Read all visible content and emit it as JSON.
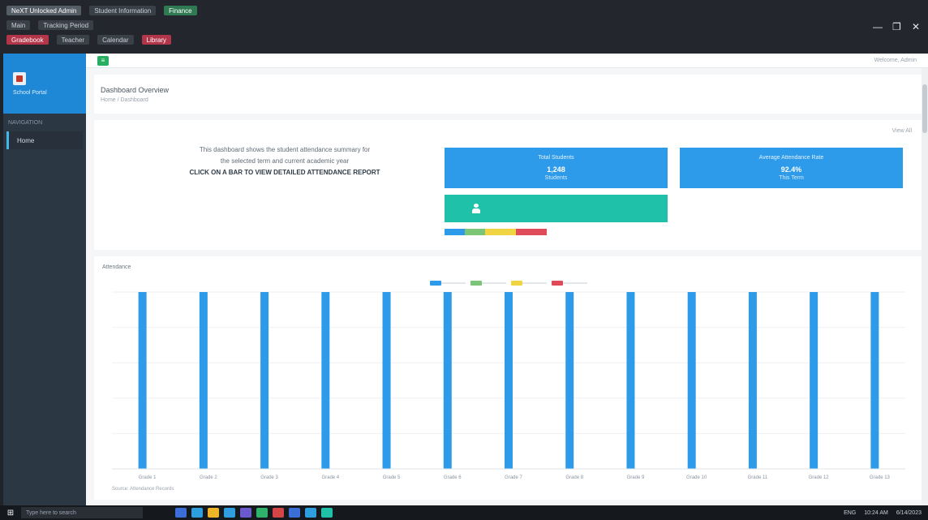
{
  "window": {
    "tabs_row1": [
      "NeXT Unlocked Admin",
      "Student Information",
      "Finance"
    ],
    "tabs_row2": [
      "Main",
      "Tracking Period"
    ],
    "tabs_row3": [
      "Gradebook",
      "Teacher",
      "Calendar",
      "Library"
    ],
    "controls": [
      "—",
      "❐",
      "✕"
    ]
  },
  "sidebar": {
    "brand_name": "School Portal",
    "nav_header": "NAVIGATION",
    "nav_item": "Home"
  },
  "topbar": {
    "menu_icon": "menu-icon",
    "right_text": "Welcome, Admin"
  },
  "page_head": {
    "title": "Dashboard Overview",
    "subtitle": "Home / Dashboard"
  },
  "panel": {
    "link": "View All",
    "desc_line1": "This dashboard shows the student attendance summary for",
    "desc_line2": "the selected term and current academic year",
    "desc_line3": "CLICK ON A BAR TO VIEW DETAILED ATTENDANCE REPORT"
  },
  "stats": [
    {
      "label": "Total Students",
      "value": "1,248",
      "unit": "Students",
      "color": "#2d9bea"
    },
    {
      "label": "Average Attendance Rate",
      "value": "92.4%",
      "unit": "This Term",
      "color": "#2d9bea"
    }
  ],
  "user_box": {
    "icon": "user-icon",
    "color": "#1fc1a9"
  },
  "level_bar": [
    {
      "color": "#2d9bea",
      "fraction": 0.2
    },
    {
      "color": "#7cc576",
      "fraction": 0.2
    },
    {
      "color": "#f1d441",
      "fraction": 0.3
    },
    {
      "color": "#e04b5a",
      "fraction": 0.3
    }
  ],
  "chart_data": {
    "type": "bar",
    "title": "Attendance",
    "categories": [
      "Grade 1",
      "Grade 2",
      "Grade 3",
      "Grade 4",
      "Grade 5",
      "Grade 6",
      "Grade 7",
      "Grade 8",
      "Grade 9",
      "Grade 10",
      "Grade 11",
      "Grade 12",
      "Grade 13"
    ],
    "values": [
      100,
      100,
      100,
      100,
      100,
      100,
      100,
      100,
      100,
      100,
      100,
      100,
      100
    ],
    "ylim": [
      0,
      100
    ],
    "grid": true,
    "bar_color": "#2d9bea",
    "legend": [
      {
        "color": "#2d9bea"
      },
      {
        "color": "#7cc576"
      },
      {
        "color": "#f1d441"
      },
      {
        "color": "#e04b5a"
      }
    ],
    "legend_position": "top-center",
    "footnote": "Source: Attendance Records"
  },
  "taskbar": {
    "start_icon": "windows-start-icon",
    "search_placeholder": "Type here to search",
    "app_colors": [
      "#3a6fd8",
      "#2f9ee0",
      "#f0b429",
      "#2f9ee0",
      "#6a5acd",
      "#2fb36a",
      "#d64545",
      "#3a6fd8",
      "#2f9ee0",
      "#1fc1a9"
    ],
    "tray_items": [
      "ENG",
      "10:24 AM",
      "6/14/2023"
    ]
  }
}
